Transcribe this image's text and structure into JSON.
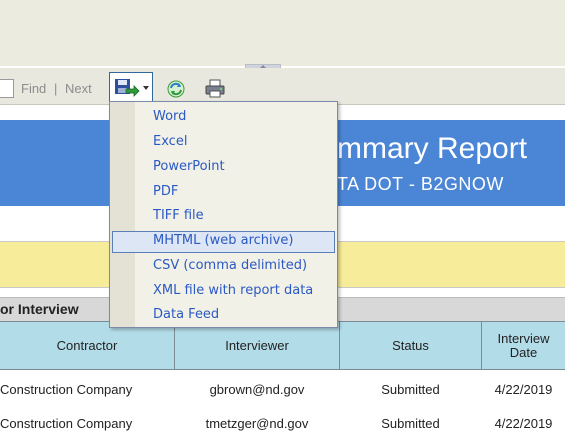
{
  "toolbar": {
    "find_label": "Find",
    "separator": "|",
    "next_label": "Next",
    "export_icon": "save-disk-icon",
    "refresh_icon": "refresh-icon",
    "print_icon": "printer-icon"
  },
  "export_menu": {
    "items": [
      {
        "label": "Word"
      },
      {
        "label": "Excel"
      },
      {
        "label": "PowerPoint"
      },
      {
        "label": "PDF"
      },
      {
        "label": "TIFF file"
      },
      {
        "label": "MHTML (web archive)"
      },
      {
        "label": "CSV (comma delimited)"
      },
      {
        "label": "XML file with report data"
      },
      {
        "label": "Data Feed"
      }
    ],
    "highlighted_index": 5
  },
  "report": {
    "title_partial": "mmary Report",
    "subtitle_partial": "TA DOT - B2GNOW",
    "section_title_partial": "or Interview",
    "columns": [
      "Contractor",
      "Interviewer",
      "Status",
      "Interview Date"
    ],
    "rows": [
      {
        "contractor": "Construction Company",
        "interviewer": "gbrown@nd.gov",
        "status": "Submitted",
        "date": "4/22/2019"
      },
      {
        "contractor": "Construction Company",
        "interviewer": "tmetzger@nd.gov",
        "status": "Submitted",
        "date": "4/22/2019"
      }
    ]
  },
  "colors": {
    "banner": "#4b86d6",
    "header_fill": "#b3dce9",
    "filter_band": "#f7ec9a",
    "menu_text": "#2b59c3"
  }
}
